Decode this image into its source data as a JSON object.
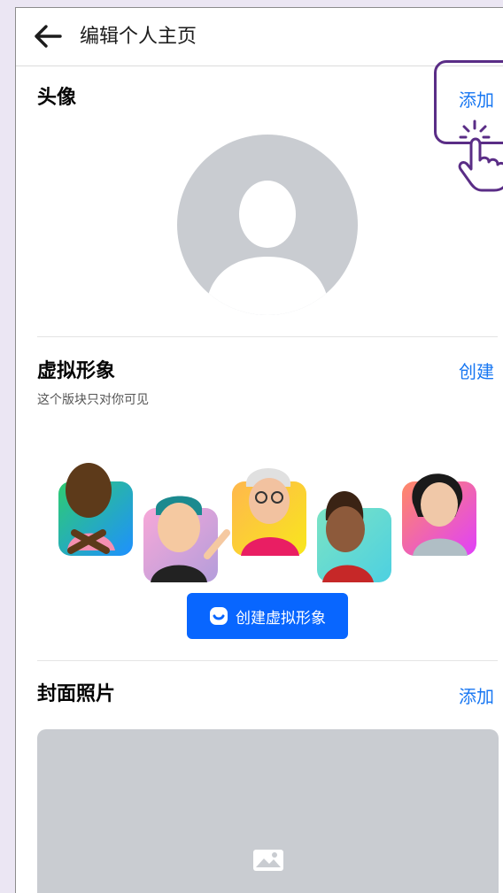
{
  "header": {
    "title": "编辑个人主页",
    "back_icon": "arrow-left-icon"
  },
  "profile_photo": {
    "title": "头像",
    "action": "添加"
  },
  "avatar_section": {
    "title": "虚拟形象",
    "action": "创建",
    "subtitle": "这个版块只对你可见",
    "button_label": "创建虚拟形象",
    "button_icon": "avatar-icon"
  },
  "cover_photo": {
    "title": "封面照片",
    "action": "添加",
    "placeholder_icon": "image-icon"
  },
  "colors": {
    "accent": "#1877f2",
    "button": "#0866ff",
    "highlight": "#5a2d86",
    "placeholder": "#c9ccd1"
  }
}
